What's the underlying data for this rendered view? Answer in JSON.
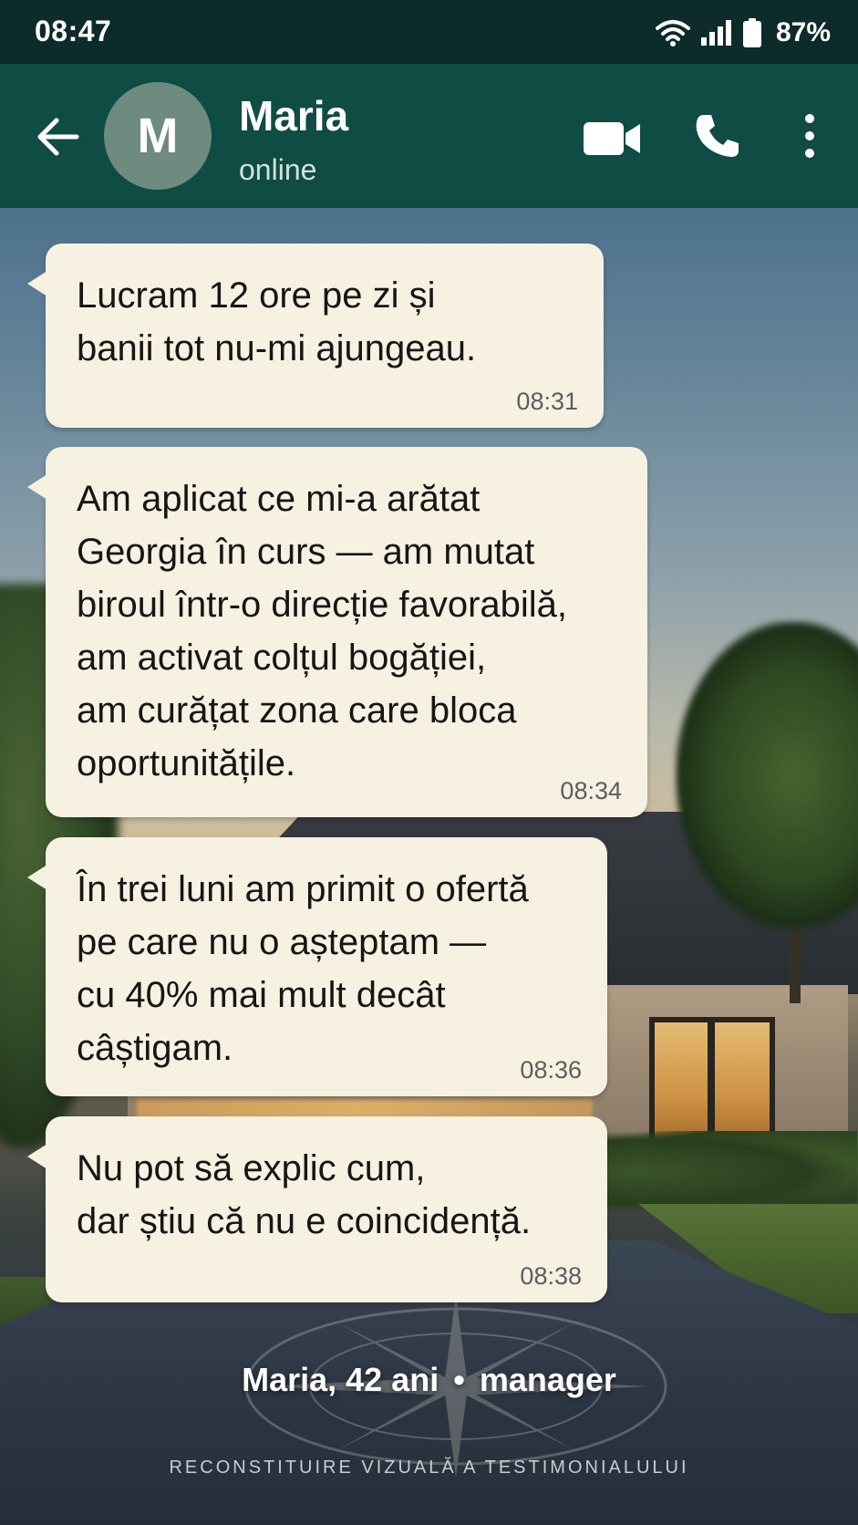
{
  "status_bar": {
    "time": "08:47",
    "battery_percent": "87%",
    "icons": [
      "wifi-icon",
      "signal-icon",
      "battery-icon"
    ]
  },
  "header": {
    "avatar_initial": "M",
    "contact_name": "Maria",
    "contact_status": "online",
    "icons": [
      "back-arrow-icon",
      "video-call-icon",
      "phone-icon",
      "more-vert-icon"
    ]
  },
  "messages": [
    {
      "lines": [
        "Lucram 12 ore pe zi și",
        "banii tot nu-mi ajungeau."
      ],
      "time": "08:31"
    },
    {
      "lines": [
        "Am aplicat ce mi-a arătat",
        "Georgia în curs — am mutat",
        "biroul într-o direcție favorabilă,",
        "am activat colțul bogăției,",
        "am curățat zona care bloca",
        "oportunitățile."
      ],
      "time": "08:34"
    },
    {
      "lines": [
        "În trei luni am primit o ofertă",
        "pe care nu o așteptam —",
        "cu 40% mai mult decât",
        "câștigam."
      ],
      "time": "08:36"
    },
    {
      "lines": [
        "Nu pot să explic cum,",
        "dar știu că nu e coincidență."
      ],
      "time": "08:38"
    }
  ],
  "caption": {
    "person": "Maria, 42 ani",
    "separator": "•",
    "role": "manager"
  },
  "footnote": "RECONSTITUIRE VIZUALĂ A TESTIMONIALULUI",
  "colors": {
    "status_bar_bg": "#0d2b2a",
    "header_bg": "#0f4c44",
    "avatar_bg": "#6d8b7e",
    "bubble_bg": "#f6f1e1"
  }
}
